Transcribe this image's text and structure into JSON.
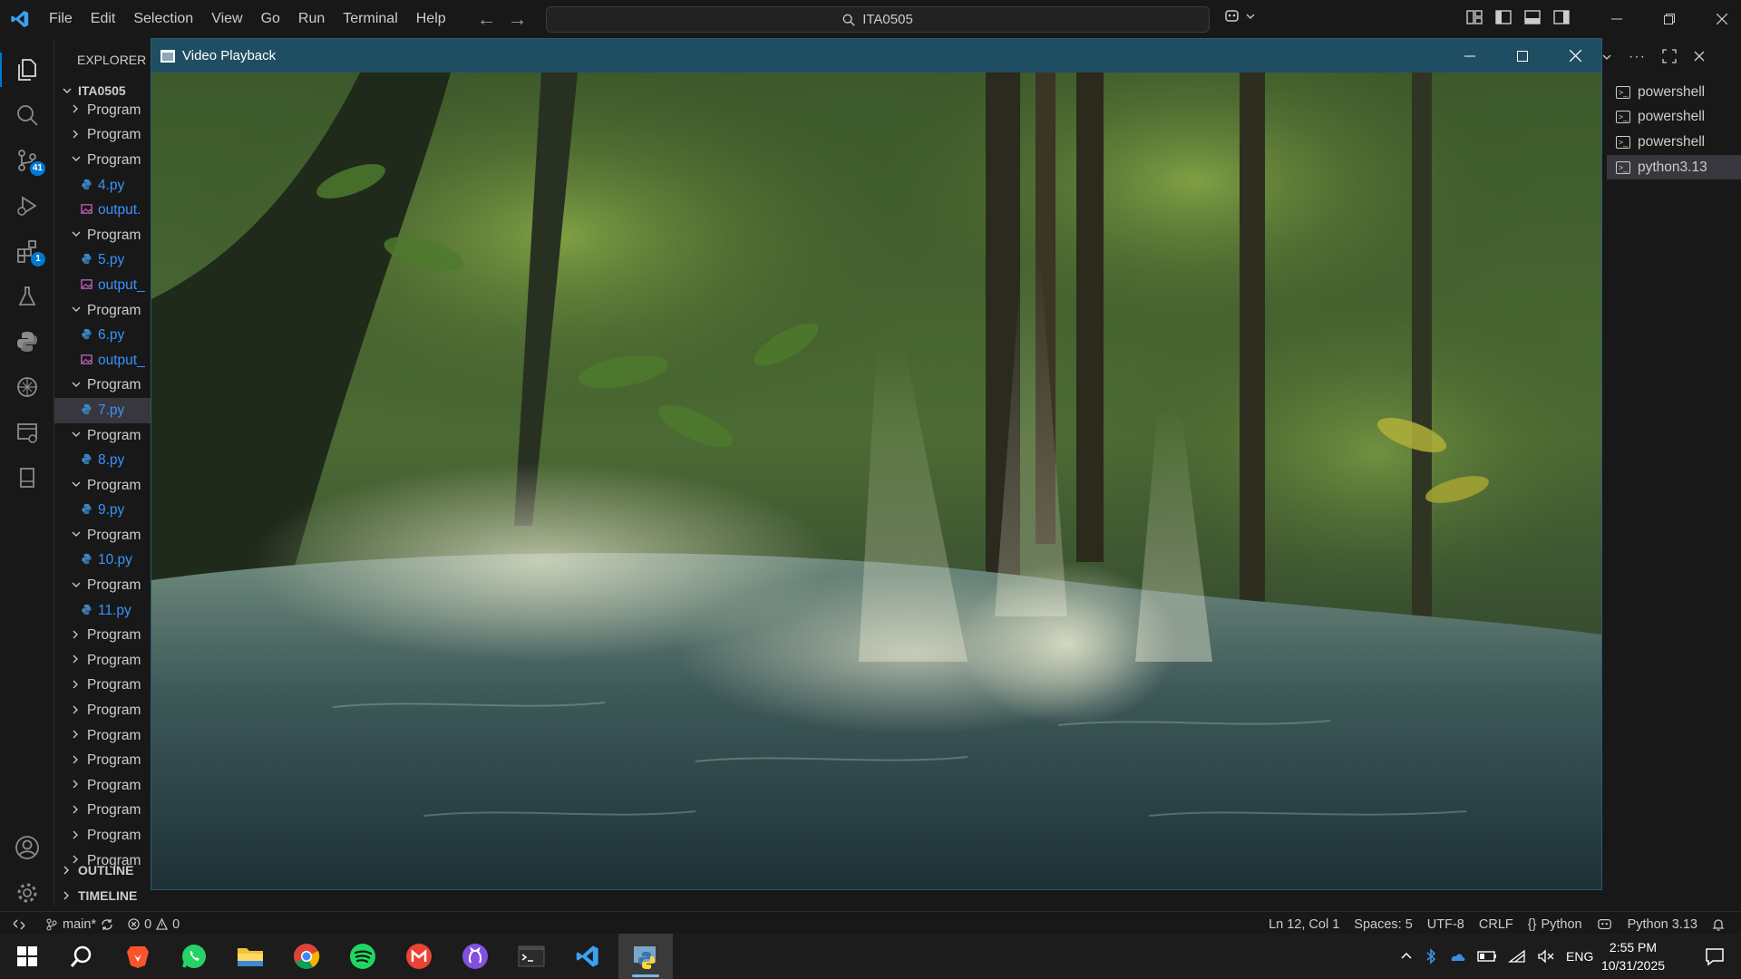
{
  "titlebar": {
    "menu": [
      "File",
      "Edit",
      "Selection",
      "View",
      "Go",
      "Run",
      "Terminal",
      "Help"
    ],
    "search_text": "ITA0505"
  },
  "activity_bar": {
    "scm_badge": "41",
    "extensions_badge": "1"
  },
  "explorer": {
    "header": "EXPLORER",
    "root": "ITA0505",
    "tree": [
      {
        "type": "folder",
        "open": false,
        "label": "Program"
      },
      {
        "type": "folder",
        "open": false,
        "label": "Program"
      },
      {
        "type": "folder",
        "open": true,
        "label": "Program"
      },
      {
        "type": "py",
        "label": "4.py"
      },
      {
        "type": "img",
        "label": "output."
      },
      {
        "type": "folder",
        "open": true,
        "label": "Program"
      },
      {
        "type": "py",
        "label": "5.py"
      },
      {
        "type": "img",
        "label": "output_"
      },
      {
        "type": "folder",
        "open": true,
        "label": "Program"
      },
      {
        "type": "py",
        "label": "6.py"
      },
      {
        "type": "img",
        "label": "output_"
      },
      {
        "type": "folder",
        "open": true,
        "label": "Program"
      },
      {
        "type": "py",
        "label": "7.py",
        "selected": true
      },
      {
        "type": "folder",
        "open": true,
        "label": "Program"
      },
      {
        "type": "py",
        "label": "8.py"
      },
      {
        "type": "folder",
        "open": true,
        "label": "Program"
      },
      {
        "type": "py",
        "label": "9.py"
      },
      {
        "type": "folder",
        "open": true,
        "label": "Program"
      },
      {
        "type": "py",
        "label": "10.py"
      },
      {
        "type": "folder",
        "open": true,
        "label": "Program"
      },
      {
        "type": "py",
        "label": "11.py"
      },
      {
        "type": "folder",
        "open": false,
        "label": "Program"
      },
      {
        "type": "folder",
        "open": false,
        "label": "Program"
      },
      {
        "type": "folder",
        "open": false,
        "label": "Program"
      },
      {
        "type": "folder",
        "open": false,
        "label": "Program"
      },
      {
        "type": "folder",
        "open": false,
        "label": "Program"
      },
      {
        "type": "folder",
        "open": false,
        "label": "Program"
      },
      {
        "type": "folder",
        "open": false,
        "label": "Program"
      },
      {
        "type": "folder",
        "open": false,
        "label": "Program"
      },
      {
        "type": "folder",
        "open": false,
        "label": "Program"
      },
      {
        "type": "folder",
        "open": false,
        "label": "Program"
      }
    ],
    "outline": "OUTLINE",
    "timeline": "TIMELINE"
  },
  "video_window": {
    "title": "Video Playback"
  },
  "terminals": {
    "items": [
      {
        "label": "powershell",
        "active": false
      },
      {
        "label": "powershell",
        "active": false
      },
      {
        "label": "powershell",
        "active": false
      },
      {
        "label": "python3.13",
        "active": true
      }
    ]
  },
  "statusbar": {
    "branch": "main*",
    "errors": "0",
    "warnings": "0",
    "position": "Ln 12, Col 1",
    "spaces": "Spaces: 5",
    "encoding": "UTF-8",
    "eol": "CRLF",
    "language": "Python",
    "interpreter": "Python 3.13"
  },
  "taskbar": {
    "apps": [
      "windows-start",
      "search",
      "brave",
      "whatsapp",
      "file-explorer",
      "chrome",
      "spotify",
      "gmail",
      "github-desktop",
      "terminal",
      "vscode",
      "python"
    ],
    "active_app": "python",
    "language": "ENG",
    "time": "2:55 PM",
    "date": "10/31/2025"
  },
  "colors": {
    "accent": "#0078d4",
    "video_window_frame": "#1f4e63",
    "file_link": "#3794ff"
  }
}
